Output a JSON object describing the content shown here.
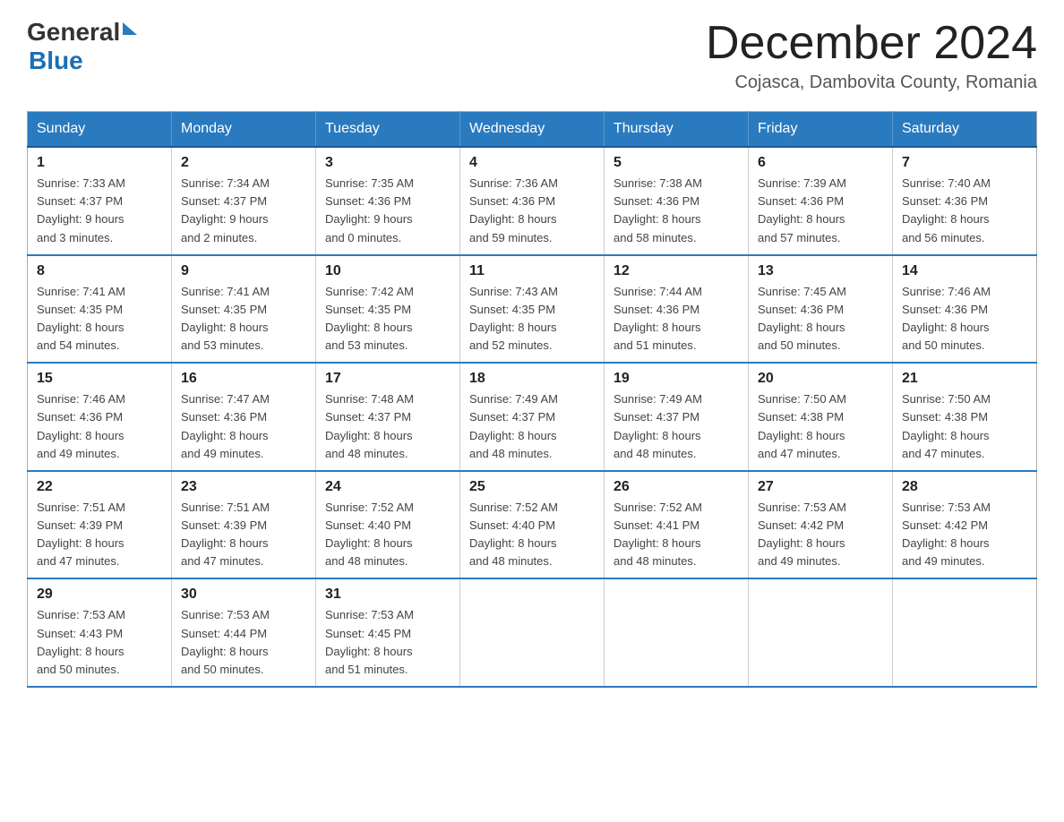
{
  "header": {
    "logo_general": "General",
    "logo_blue": "Blue",
    "month_title": "December 2024",
    "location": "Cojasca, Dambovita County, Romania"
  },
  "weekdays": [
    "Sunday",
    "Monday",
    "Tuesday",
    "Wednesday",
    "Thursday",
    "Friday",
    "Saturday"
  ],
  "weeks": [
    [
      {
        "day": "1",
        "sunrise": "7:33 AM",
        "sunset": "4:37 PM",
        "daylight": "9 hours and 3 minutes."
      },
      {
        "day": "2",
        "sunrise": "7:34 AM",
        "sunset": "4:37 PM",
        "daylight": "9 hours and 2 minutes."
      },
      {
        "day": "3",
        "sunrise": "7:35 AM",
        "sunset": "4:36 PM",
        "daylight": "9 hours and 0 minutes."
      },
      {
        "day": "4",
        "sunrise": "7:36 AM",
        "sunset": "4:36 PM",
        "daylight": "8 hours and 59 minutes."
      },
      {
        "day": "5",
        "sunrise": "7:38 AM",
        "sunset": "4:36 PM",
        "daylight": "8 hours and 58 minutes."
      },
      {
        "day": "6",
        "sunrise": "7:39 AM",
        "sunset": "4:36 PM",
        "daylight": "8 hours and 57 minutes."
      },
      {
        "day": "7",
        "sunrise": "7:40 AM",
        "sunset": "4:36 PM",
        "daylight": "8 hours and 56 minutes."
      }
    ],
    [
      {
        "day": "8",
        "sunrise": "7:41 AM",
        "sunset": "4:35 PM",
        "daylight": "8 hours and 54 minutes."
      },
      {
        "day": "9",
        "sunrise": "7:41 AM",
        "sunset": "4:35 PM",
        "daylight": "8 hours and 53 minutes."
      },
      {
        "day": "10",
        "sunrise": "7:42 AM",
        "sunset": "4:35 PM",
        "daylight": "8 hours and 53 minutes."
      },
      {
        "day": "11",
        "sunrise": "7:43 AM",
        "sunset": "4:35 PM",
        "daylight": "8 hours and 52 minutes."
      },
      {
        "day": "12",
        "sunrise": "7:44 AM",
        "sunset": "4:36 PM",
        "daylight": "8 hours and 51 minutes."
      },
      {
        "day": "13",
        "sunrise": "7:45 AM",
        "sunset": "4:36 PM",
        "daylight": "8 hours and 50 minutes."
      },
      {
        "day": "14",
        "sunrise": "7:46 AM",
        "sunset": "4:36 PM",
        "daylight": "8 hours and 50 minutes."
      }
    ],
    [
      {
        "day": "15",
        "sunrise": "7:46 AM",
        "sunset": "4:36 PM",
        "daylight": "8 hours and 49 minutes."
      },
      {
        "day": "16",
        "sunrise": "7:47 AM",
        "sunset": "4:36 PM",
        "daylight": "8 hours and 49 minutes."
      },
      {
        "day": "17",
        "sunrise": "7:48 AM",
        "sunset": "4:37 PM",
        "daylight": "8 hours and 48 minutes."
      },
      {
        "day": "18",
        "sunrise": "7:49 AM",
        "sunset": "4:37 PM",
        "daylight": "8 hours and 48 minutes."
      },
      {
        "day": "19",
        "sunrise": "7:49 AM",
        "sunset": "4:37 PM",
        "daylight": "8 hours and 48 minutes."
      },
      {
        "day": "20",
        "sunrise": "7:50 AM",
        "sunset": "4:38 PM",
        "daylight": "8 hours and 47 minutes."
      },
      {
        "day": "21",
        "sunrise": "7:50 AM",
        "sunset": "4:38 PM",
        "daylight": "8 hours and 47 minutes."
      }
    ],
    [
      {
        "day": "22",
        "sunrise": "7:51 AM",
        "sunset": "4:39 PM",
        "daylight": "8 hours and 47 minutes."
      },
      {
        "day": "23",
        "sunrise": "7:51 AM",
        "sunset": "4:39 PM",
        "daylight": "8 hours and 47 minutes."
      },
      {
        "day": "24",
        "sunrise": "7:52 AM",
        "sunset": "4:40 PM",
        "daylight": "8 hours and 48 minutes."
      },
      {
        "day": "25",
        "sunrise": "7:52 AM",
        "sunset": "4:40 PM",
        "daylight": "8 hours and 48 minutes."
      },
      {
        "day": "26",
        "sunrise": "7:52 AM",
        "sunset": "4:41 PM",
        "daylight": "8 hours and 48 minutes."
      },
      {
        "day": "27",
        "sunrise": "7:53 AM",
        "sunset": "4:42 PM",
        "daylight": "8 hours and 49 minutes."
      },
      {
        "day": "28",
        "sunrise": "7:53 AM",
        "sunset": "4:42 PM",
        "daylight": "8 hours and 49 minutes."
      }
    ],
    [
      {
        "day": "29",
        "sunrise": "7:53 AM",
        "sunset": "4:43 PM",
        "daylight": "8 hours and 50 minutes."
      },
      {
        "day": "30",
        "sunrise": "7:53 AM",
        "sunset": "4:44 PM",
        "daylight": "8 hours and 50 minutes."
      },
      {
        "day": "31",
        "sunrise": "7:53 AM",
        "sunset": "4:45 PM",
        "daylight": "8 hours and 51 minutes."
      },
      null,
      null,
      null,
      null
    ]
  ],
  "labels": {
    "sunrise": "Sunrise:",
    "sunset": "Sunset:",
    "daylight": "Daylight:"
  }
}
